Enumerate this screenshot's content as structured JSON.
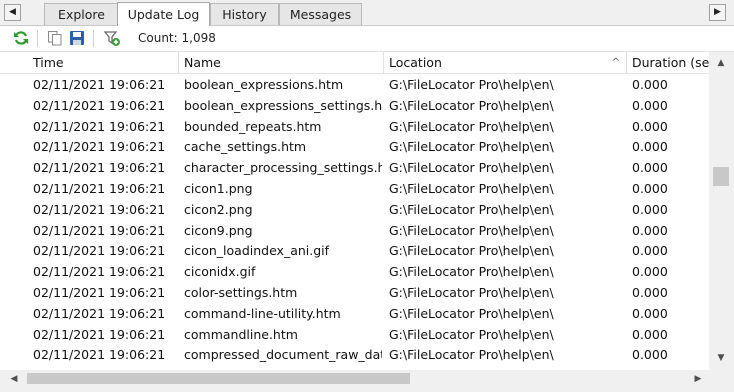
{
  "tabs": [
    {
      "label": "Explore"
    },
    {
      "label": "Update Log",
      "active": true
    },
    {
      "label": "History"
    },
    {
      "label": "Messages"
    }
  ],
  "toolbar": {
    "icons": [
      "refresh-icon",
      "copy-icon",
      "save-icon",
      "filter-add-icon"
    ],
    "count_label": "Count: 1,098"
  },
  "columns": [
    {
      "label": "Time"
    },
    {
      "label": "Name"
    },
    {
      "label": "Location",
      "sorted": "ascending"
    },
    {
      "label": "Duration (sec"
    }
  ],
  "rows": [
    {
      "time": "02/11/2021 19:06:21",
      "name": "boolean_expressions.htm",
      "location": "G:\\FileLocator Pro\\help\\en\\",
      "duration": "0.000"
    },
    {
      "time": "02/11/2021 19:06:21",
      "name": "boolean_expressions_settings.htm",
      "location": "G:\\FileLocator Pro\\help\\en\\",
      "duration": "0.000"
    },
    {
      "time": "02/11/2021 19:06:21",
      "name": "bounded_repeats.htm",
      "location": "G:\\FileLocator Pro\\help\\en\\",
      "duration": "0.000"
    },
    {
      "time": "02/11/2021 19:06:21",
      "name": "cache_settings.htm",
      "location": "G:\\FileLocator Pro\\help\\en\\",
      "duration": "0.000"
    },
    {
      "time": "02/11/2021 19:06:21",
      "name": "character_processing_settings.htm",
      "location": "G:\\FileLocator Pro\\help\\en\\",
      "duration": "0.000"
    },
    {
      "time": "02/11/2021 19:06:21",
      "name": "cicon1.png",
      "location": "G:\\FileLocator Pro\\help\\en\\",
      "duration": "0.000"
    },
    {
      "time": "02/11/2021 19:06:21",
      "name": "cicon2.png",
      "location": "G:\\FileLocator Pro\\help\\en\\",
      "duration": "0.000"
    },
    {
      "time": "02/11/2021 19:06:21",
      "name": "cicon9.png",
      "location": "G:\\FileLocator Pro\\help\\en\\",
      "duration": "0.000"
    },
    {
      "time": "02/11/2021 19:06:21",
      "name": "cicon_loadindex_ani.gif",
      "location": "G:\\FileLocator Pro\\help\\en\\",
      "duration": "0.000"
    },
    {
      "time": "02/11/2021 19:06:21",
      "name": "ciconidx.gif",
      "location": "G:\\FileLocator Pro\\help\\en\\",
      "duration": "0.000"
    },
    {
      "time": "02/11/2021 19:06:21",
      "name": "color-settings.htm",
      "location": "G:\\FileLocator Pro\\help\\en\\",
      "duration": "0.000"
    },
    {
      "time": "02/11/2021 19:06:21",
      "name": "command-line-utility.htm",
      "location": "G:\\FileLocator Pro\\help\\en\\",
      "duration": "0.000"
    },
    {
      "time": "02/11/2021 19:06:21",
      "name": "commandline.htm",
      "location": "G:\\FileLocator Pro\\help\\en\\",
      "duration": "0.000"
    },
    {
      "time": "02/11/2021 19:06:21",
      "name": "compressed_document_raw_dat...",
      "location": "G:\\FileLocator Pro\\help\\en\\",
      "duration": "0.000"
    }
  ],
  "colors": {
    "refresh": "#2e9a2e",
    "save": "#2b5fa8",
    "filter": "#6a6a6a",
    "add": "#3a9b3a"
  }
}
